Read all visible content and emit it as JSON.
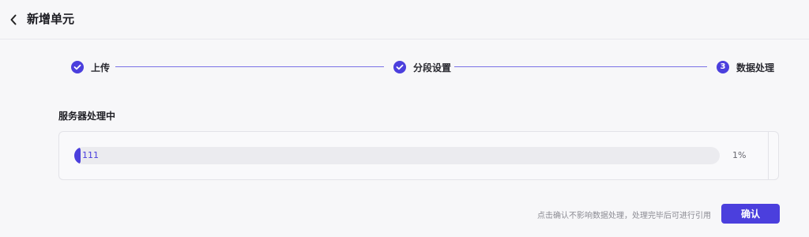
{
  "header": {
    "title": "新增单元",
    "back_icon": "chevron-left-icon"
  },
  "steps": [
    {
      "label": "上传",
      "status": "done",
      "icon": "check-circle-icon"
    },
    {
      "label": "分段设置",
      "status": "done",
      "icon": "check-circle-icon"
    },
    {
      "label": "数据处理",
      "status": "current",
      "number": "3"
    }
  ],
  "section": {
    "title": "服务器处理中"
  },
  "progress": {
    "item_name": "111",
    "percent_label": "1%",
    "percent_value": 0.01
  },
  "footer": {
    "hint": "点击确认不影响数据处理，处理完毕后可进行引用",
    "confirm_label": "确认"
  },
  "colors": {
    "accent": "#4b3fdd",
    "background": "#f7f7f9"
  }
}
